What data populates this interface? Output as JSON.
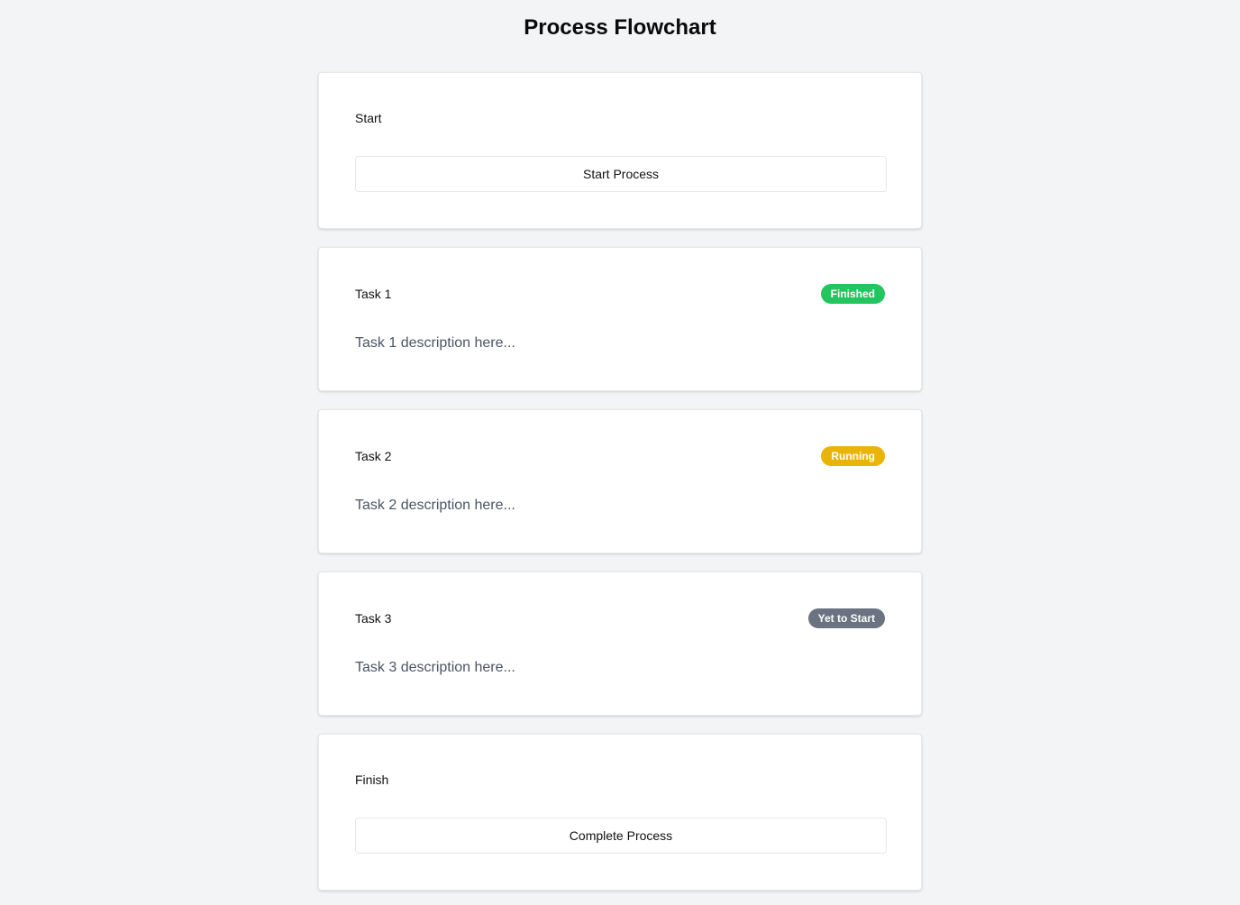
{
  "page": {
    "title": "Process Flowchart"
  },
  "start": {
    "label": "Start",
    "button_label": "Start Process"
  },
  "tasks": [
    {
      "label": "Task 1",
      "status": "Finished",
      "status_color": "#22c55e",
      "description": "Task 1 description here..."
    },
    {
      "label": "Task 2",
      "status": "Running",
      "status_color": "#eab308",
      "description": "Task 2 description here..."
    },
    {
      "label": "Task 3",
      "status": "Yet to Start",
      "status_color": "#6b7280",
      "description": "Task 3 description here..."
    }
  ],
  "finish": {
    "label": "Finish",
    "button_label": "Complete Process"
  }
}
